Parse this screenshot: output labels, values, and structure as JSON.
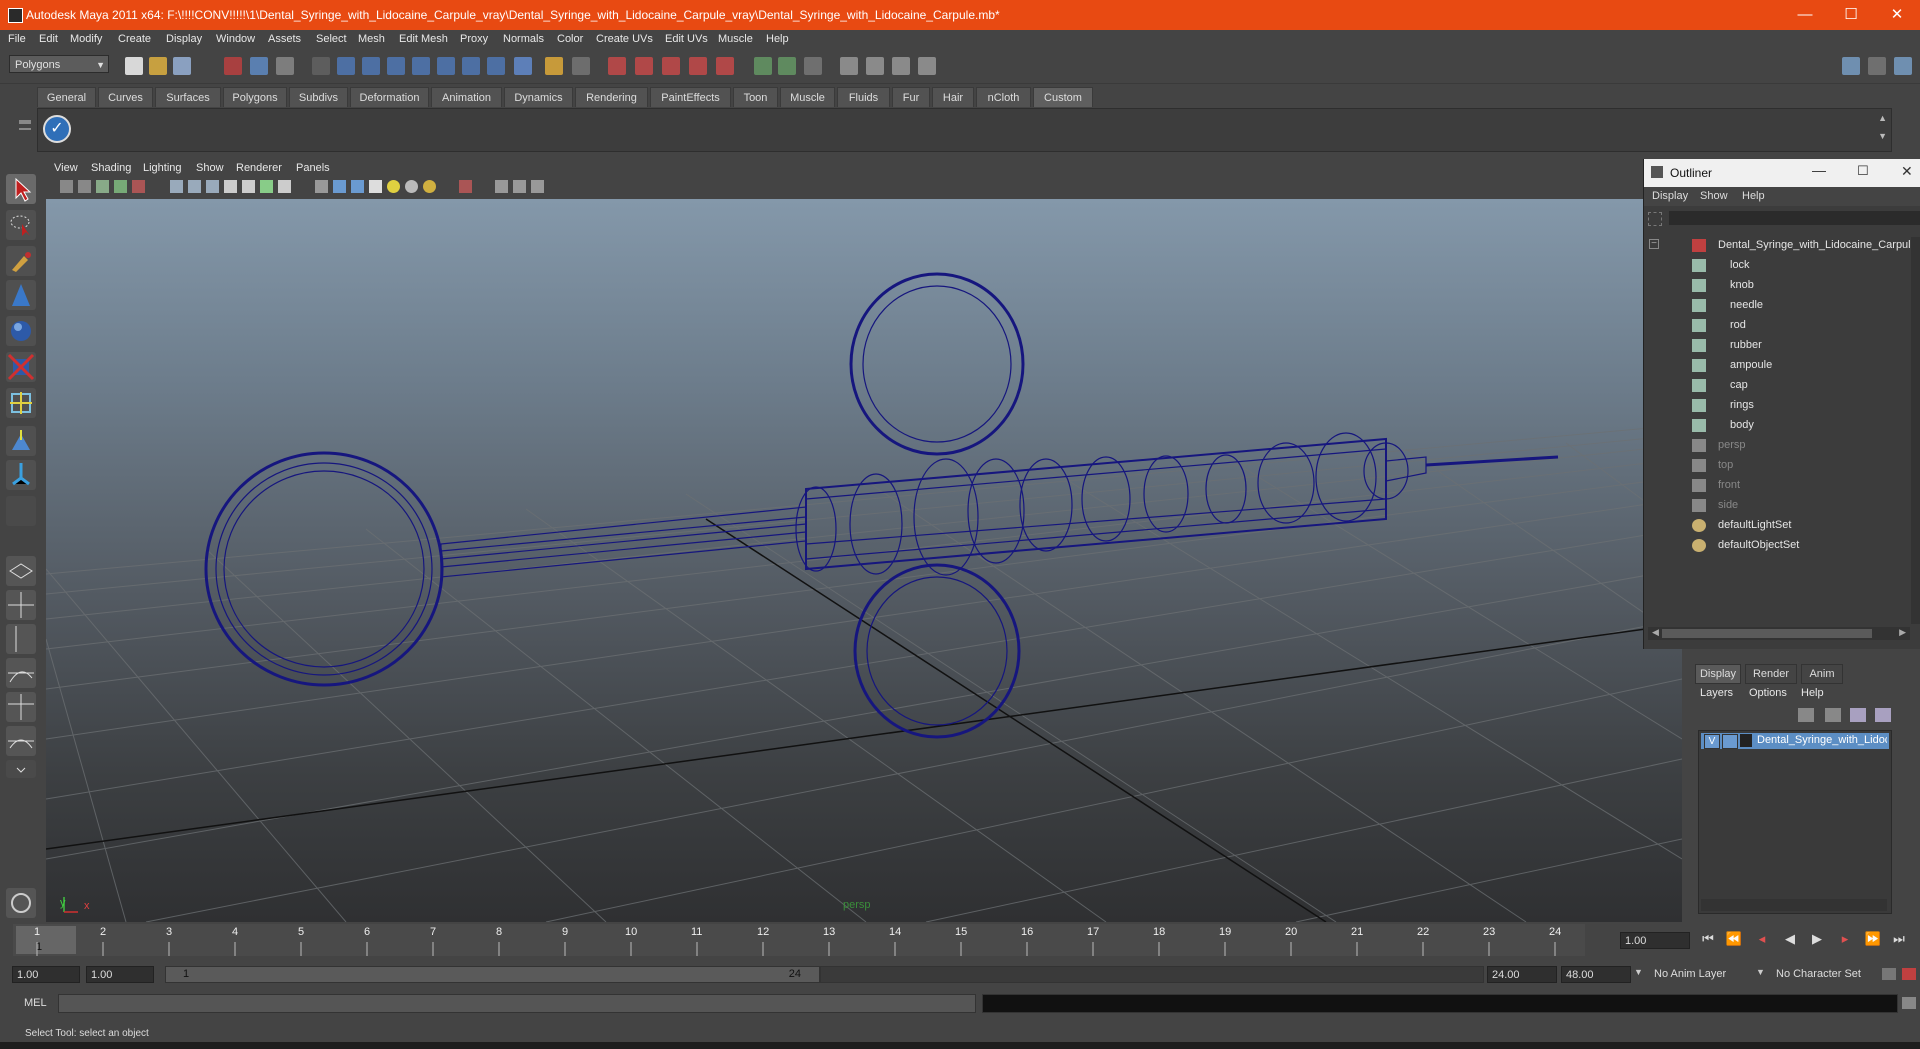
{
  "window": {
    "title": "Autodesk Maya 2011 x64: F:\\!!!!CONV!!!!!\\1\\Dental_Syringe_with_Lidocaine_Carpule_vray\\Dental_Syringe_with_Lidocaine_Carpule_vray\\Dental_Syringe_with_Lidocaine_Carpule.mb*",
    "minimize": "—",
    "maximize": "☐",
    "close": "✕"
  },
  "menubar": [
    "File",
    "Edit",
    "Modify",
    "Create",
    "Display",
    "Window",
    "Assets",
    "Select",
    "Mesh",
    "Edit Mesh",
    "Proxy",
    "Normals",
    "Color",
    "Create UVs",
    "Edit UVs",
    "Muscle",
    "Help"
  ],
  "statusline": {
    "mode": "Polygons"
  },
  "shelf": {
    "tabs": [
      "General",
      "Curves",
      "Surfaces",
      "Polygons",
      "Subdivs",
      "Deformation",
      "Animation",
      "Dynamics",
      "Rendering",
      "PaintEffects",
      "Toon",
      "Muscle",
      "Fluids",
      "Fur",
      "Hair",
      "nCloth",
      "Custom"
    ],
    "active": "Custom"
  },
  "panel": {
    "menu": [
      "View",
      "Shading",
      "Lighting",
      "Show",
      "Renderer",
      "Panels"
    ],
    "camera": "persp",
    "axis_y": "y",
    "axis_x": "x"
  },
  "outliner": {
    "title": "Outliner",
    "menu": [
      "Display",
      "Show",
      "Help"
    ],
    "root": "Dental_Syringe_with_Lidocaine_Carpule",
    "children": [
      "lock",
      "knob",
      "needle",
      "rod",
      "rubber",
      "ampoule",
      "cap",
      "rings",
      "body"
    ],
    "cameras": [
      "persp",
      "top",
      "front",
      "side"
    ],
    "sets": [
      "defaultLightSet",
      "defaultObjectSet"
    ]
  },
  "layers": {
    "tabs": [
      "Display",
      "Render",
      "Anim"
    ],
    "menu": [
      "Layers",
      "Options",
      "Help"
    ],
    "layer_v": "V",
    "layer_name": "Dental_Syringe_with_Lidocaine_Carpule"
  },
  "timeline": {
    "ticks": [
      "1",
      "2",
      "3",
      "4",
      "5",
      "6",
      "7",
      "8",
      "9",
      "10",
      "11",
      "12",
      "13",
      "14",
      "15",
      "16",
      "17",
      "18",
      "19",
      "20",
      "21",
      "22",
      "23",
      "24"
    ],
    "current_frame": "1",
    "current_time": "1.00"
  },
  "range": {
    "start": "1.00",
    "playback_start": "1.00",
    "range_start": "1",
    "range_end": "24",
    "playback_end": "24.00",
    "end": "48.00",
    "anim_layer": "No Anim Layer",
    "character_set": "No Character Set"
  },
  "command": {
    "label": "MEL"
  },
  "help": {
    "text": "Select Tool: select an object"
  }
}
